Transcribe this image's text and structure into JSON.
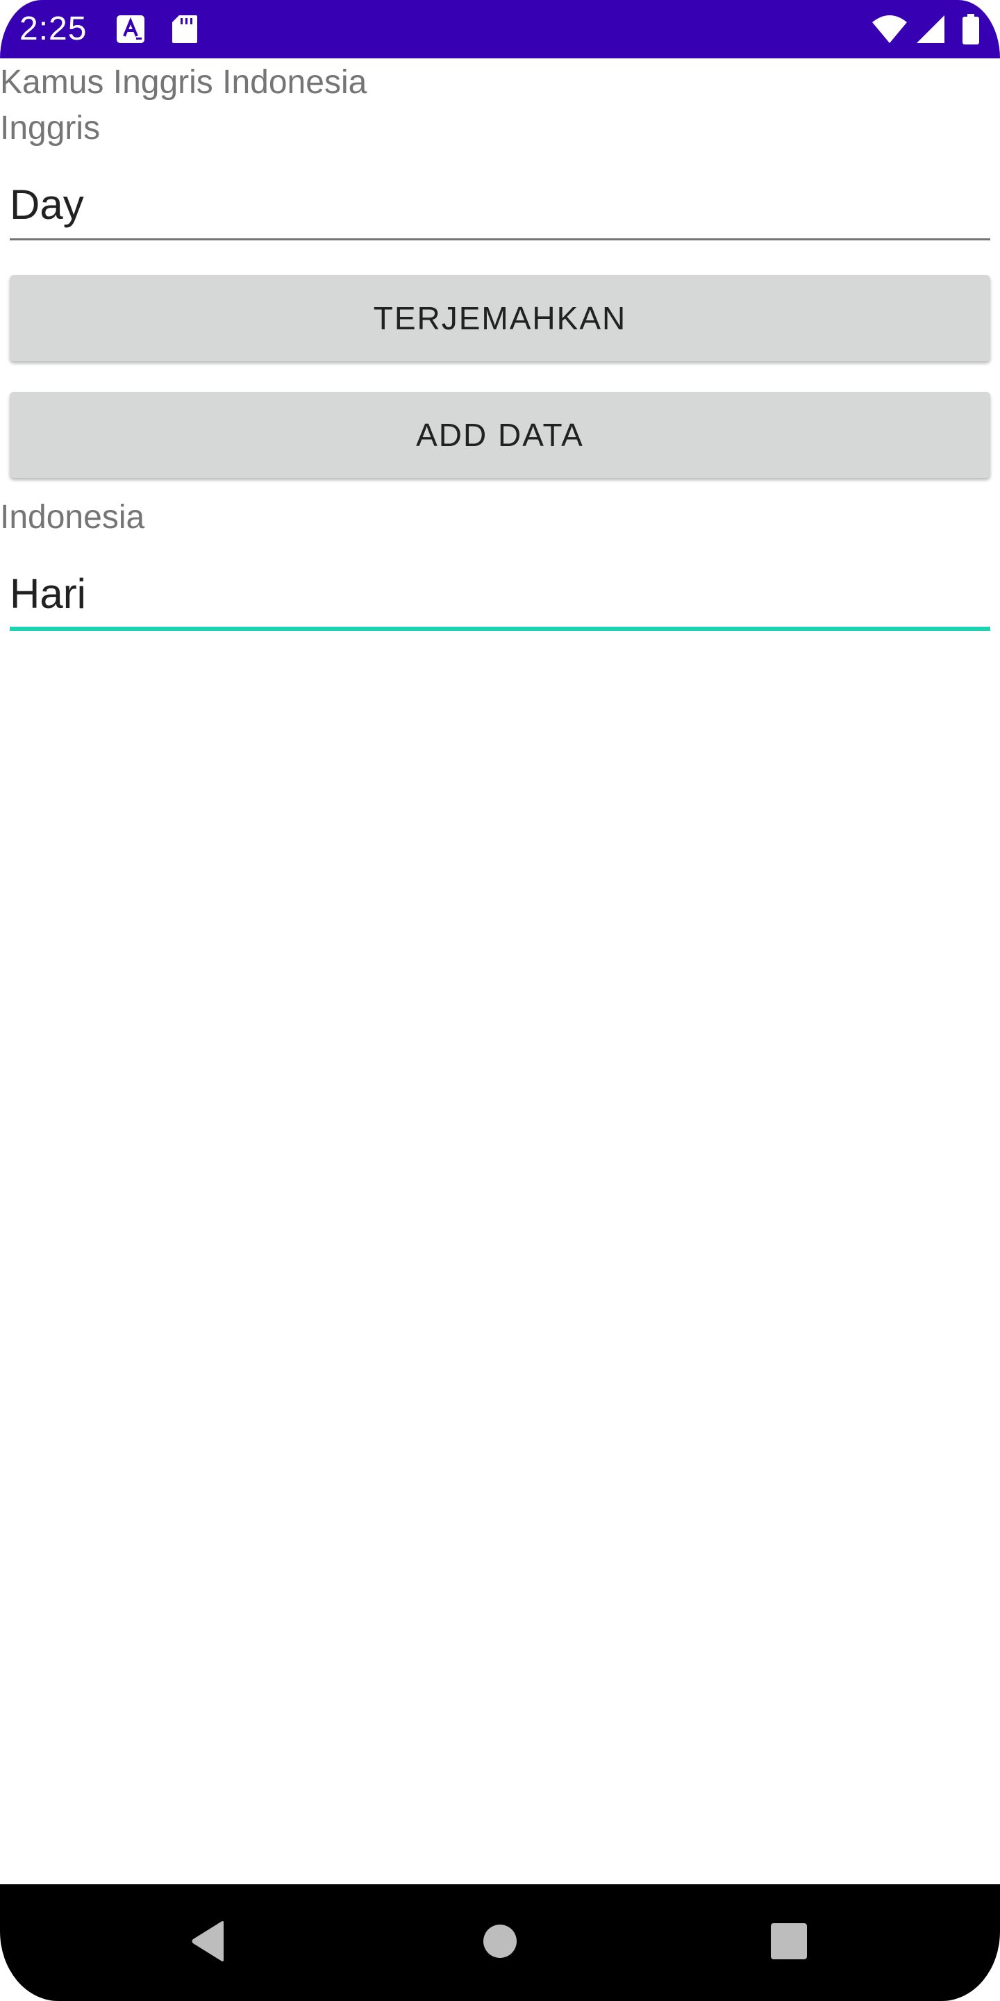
{
  "status_bar": {
    "time": "2:25",
    "background_color": "#3700b3",
    "icons": [
      "a-notification-icon",
      "sd-card-icon",
      "wifi-icon",
      "cell-signal-icon",
      "battery-icon"
    ]
  },
  "app": {
    "title": "Kamus Inggris Indonesia",
    "source_label": "Inggris",
    "source_input_value": "Day",
    "translate_button_label": "TERJEMAHKAN",
    "add_data_button_label": "ADD DATA",
    "target_label": "Indonesia",
    "target_input_value": "Hari",
    "accent_color": "#19d3b3"
  },
  "nav_bar": {
    "icons": [
      "back-icon",
      "home-icon",
      "recents-icon"
    ]
  }
}
